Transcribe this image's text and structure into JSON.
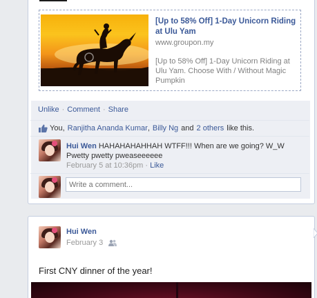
{
  "share": {
    "title": "[Up to 58% Off] 1-Day Unicorn Riding at Ulu Yam",
    "domain": "www.groupon.my",
    "description": "[Up to 58% Off] 1-Day Unicorn Riding at Ulu Yam. Choose With / Without Magic Pumpkin"
  },
  "actions": {
    "unlike": "Unlike",
    "comment": "Comment",
    "share": "Share",
    "separator": "·"
  },
  "likes": {
    "you": "You,",
    "person1": "Ranjitha Ananda Kumar",
    "comma": ",",
    "person2": "Billy Ng",
    "and": "and",
    "others": "2 others",
    "suffix": "like this."
  },
  "comment": {
    "author": "Hui Wen",
    "text": "HAHAHAHAHHAH WTFF!!! When are we going? W_W Pwetty pwetty pweaseeeeee",
    "timestamp": "February 5 at 10:36pm",
    "like_label": "Like",
    "separator": "·"
  },
  "write_comment": {
    "placeholder": "Write a comment..."
  },
  "post2": {
    "author": "Hui Wen",
    "date": "February 3",
    "text": "First CNY dinner of the year!"
  },
  "icons": {
    "like": "thumbs-up-icon",
    "audience": "friends-icon"
  },
  "colors": {
    "link": "#3b5998",
    "ufi_background": "#edeff4",
    "page_background": "#e9ebee"
  }
}
